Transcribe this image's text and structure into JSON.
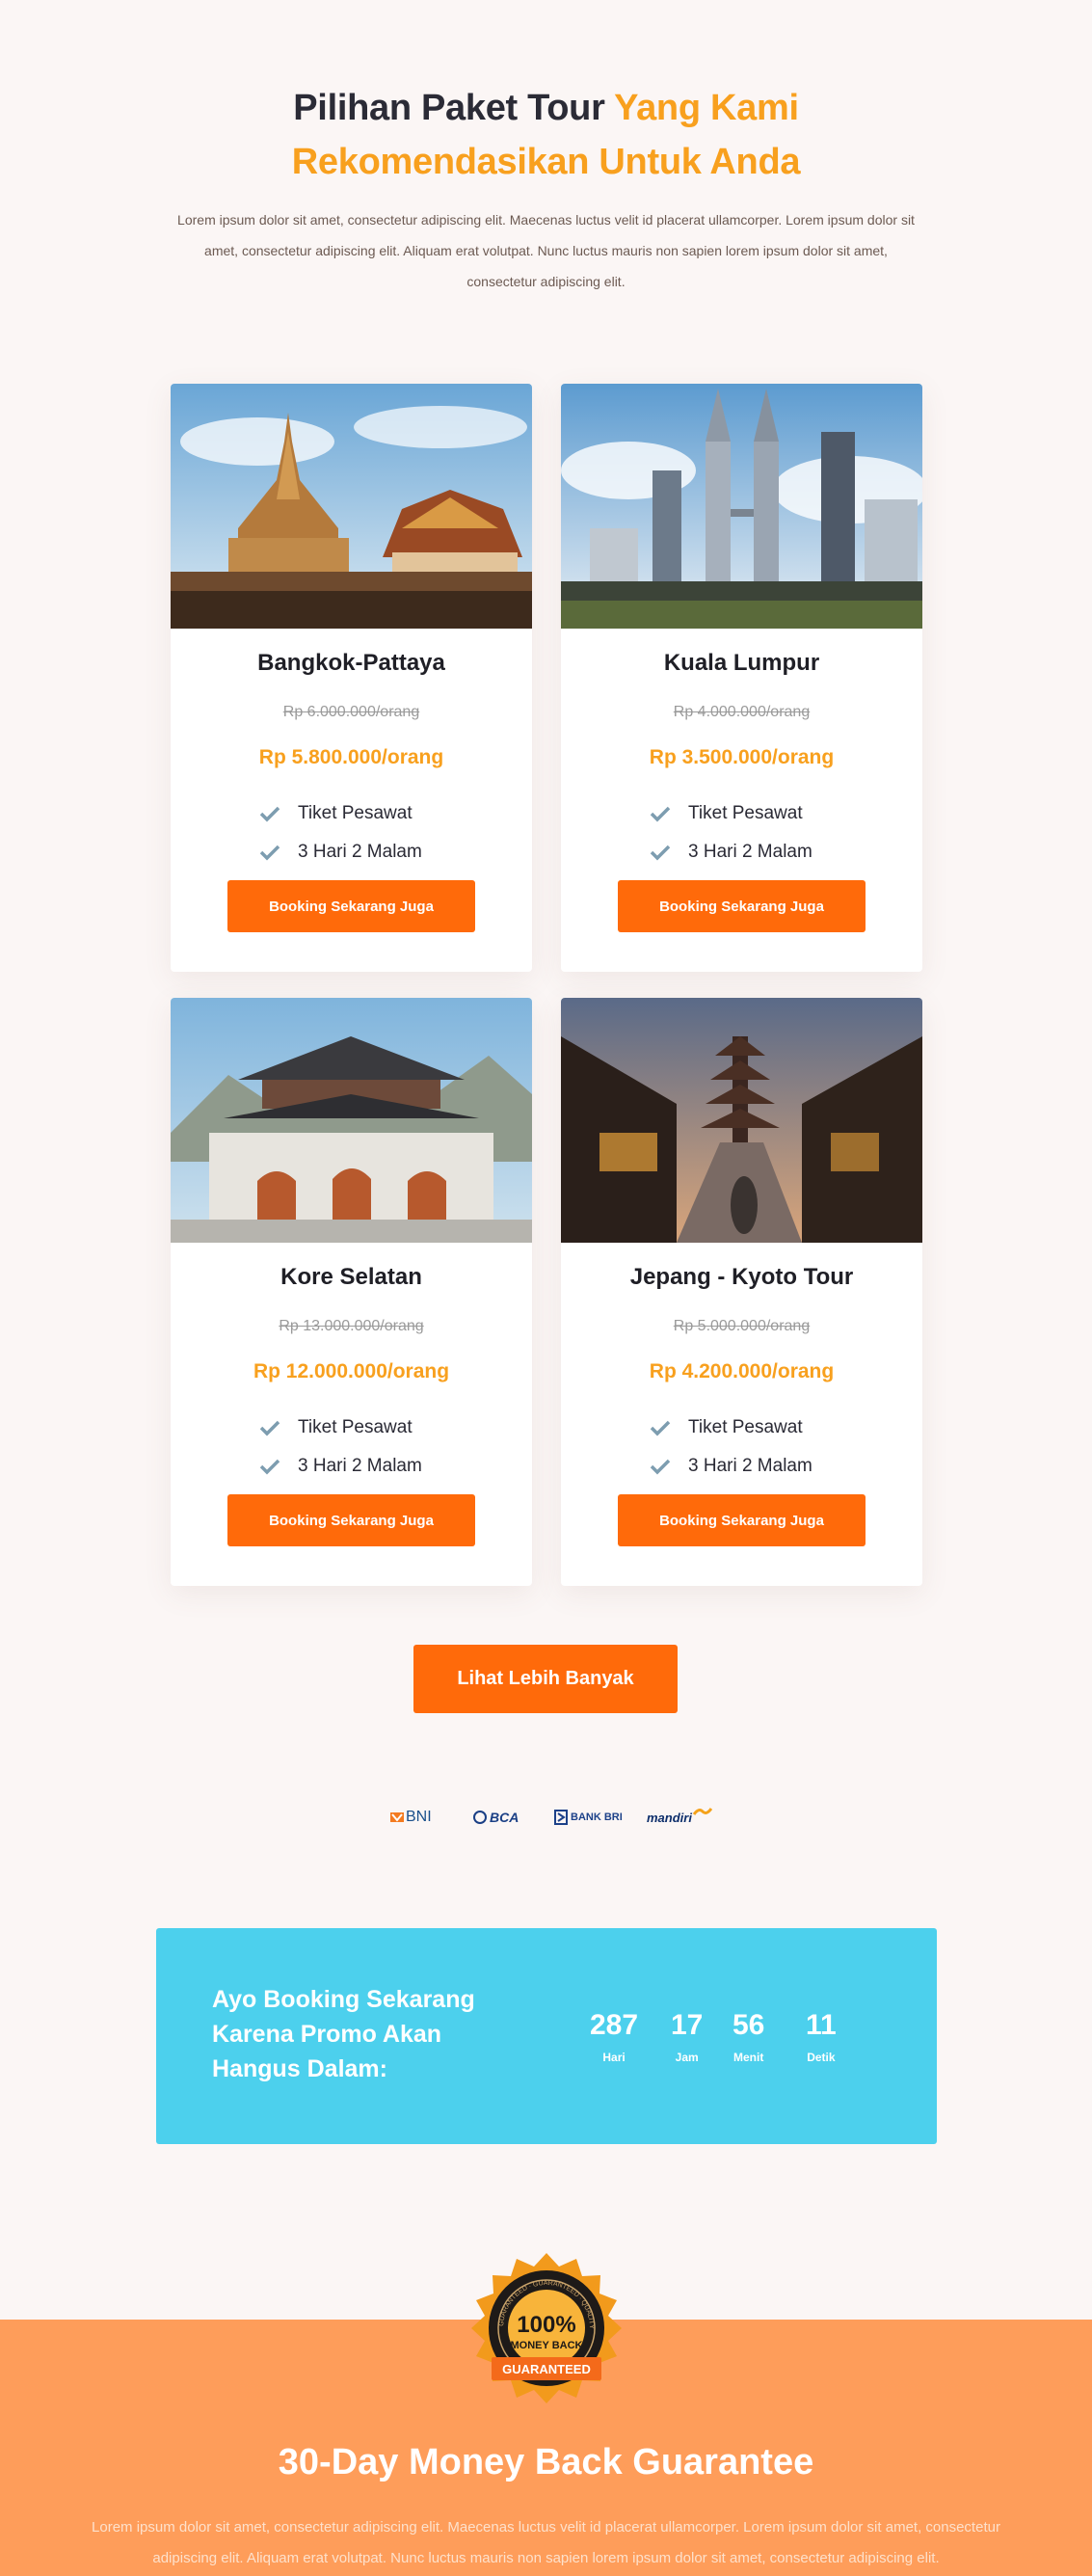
{
  "section": {
    "title_main": "Pilihan Paket Tour ",
    "title_accent_line1": "Yang Kami",
    "title_accent_line2": "Rekomendasikan Untuk Anda",
    "intro": "Lorem ipsum dolor sit amet, consectetur adipiscing elit. Maecenas luctus velit id placerat ullamcorper. Lorem ipsum dolor sit amet, consectetur adipiscing elit. Aliquam erat volutpat. Nunc luctus mauris non sapien lorem ipsum dolor sit amet, consectetur adipiscing elit."
  },
  "packages": [
    {
      "title": "Bangkok-Pattaya",
      "old_price": "Rp 6.000.000/orang",
      "price": "Rp 5.800.000/orang",
      "features": [
        "Tiket Pesawat",
        "3 Hari 2 Malam"
      ],
      "button": "Booking Sekarang Juga",
      "image": "thai-temple-photo"
    },
    {
      "title": "Kuala Lumpur",
      "old_price": "Rp 4.000.000/orang",
      "price": "Rp 3.500.000/orang",
      "features": [
        "Tiket Pesawat",
        "3 Hari 2 Malam"
      ],
      "button": "Booking Sekarang Juga",
      "image": "petronas-towers-photo"
    },
    {
      "title": "Kore Selatan",
      "old_price": "Rp 13.000.000/orang",
      "price": "Rp 12.000.000/orang",
      "features": [
        "Tiket Pesawat",
        "3 Hari 2 Malam"
      ],
      "button": "Booking Sekarang Juga",
      "image": "korean-palace-gate-photo"
    },
    {
      "title": "Jepang - Kyoto Tour",
      "old_price": "Rp 5.000.000/orang",
      "price": "Rp 4.200.000/orang",
      "features": [
        "Tiket Pesawat",
        "3 Hari 2 Malam"
      ],
      "button": "Booking Sekarang Juga",
      "image": "kyoto-pagoda-street-photo"
    }
  ],
  "more_button": "Lihat Lebih Banyak",
  "banks": [
    {
      "name": "BNI",
      "color": "#1a4f8b",
      "accent": "#f47b20"
    },
    {
      "name": "BCA",
      "color": "#1a3f85"
    },
    {
      "name": "BANK BRI",
      "color": "#1c4189"
    },
    {
      "name": "mandiri",
      "color": "#0d2e6b",
      "accent": "#f4a21b"
    }
  ],
  "countdown": {
    "title": "Ayo Booking Sekarang Karena Promo Akan Hangus Dalam:",
    "units": [
      {
        "value": "287",
        "label": "Hari"
      },
      {
        "value": "17",
        "label": "Jam"
      },
      {
        "value": "56",
        "label": "Menit"
      },
      {
        "value": "11",
        "label": "Detik"
      }
    ]
  },
  "guarantee": {
    "badge_top": "100%",
    "badge_mid": "MONEY BACK",
    "badge_ribbon": "GUARANTEED",
    "badge_ring": "GUARANTEED · GUARANTEED · QUALITY",
    "title": "30-Day Money Back Guarantee",
    "text": "Lorem ipsum dolor sit amet, consectetur adipiscing elit. Maecenas luctus velit id placerat ullamcorper. Lorem ipsum dolor sit amet, consectetur adipiscing elit. Aliquam erat volutpat. Nunc luctus mauris non sapien lorem ipsum dolor sit amet, consectetur adipiscing elit."
  },
  "colors": {
    "accent": "#f8a01e",
    "button": "#ff6a0a",
    "countdown_bg": "#4cd0ed",
    "guarantee_bg": "#fe9d5a",
    "check": "#7d9db0"
  }
}
